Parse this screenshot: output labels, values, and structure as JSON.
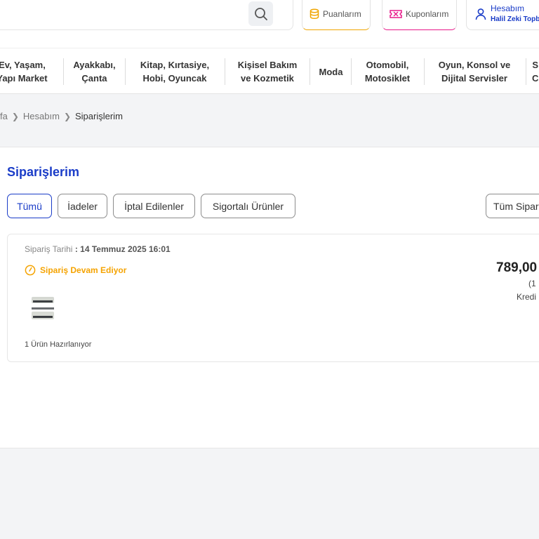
{
  "header": {
    "points_label": "Puanlarım",
    "coupons_label": "Kuponlarım",
    "account_title": "Hesabım",
    "account_name": "Halil Zeki Topb"
  },
  "categories": [
    {
      "line1": "Ev, Yaşam,",
      "line2": "Yapı Market"
    },
    {
      "line1": "Ayakkabı,",
      "line2": "Çanta"
    },
    {
      "line1": "Kitap, Kırtasiye,",
      "line2": "Hobi, Oyuncak"
    },
    {
      "line1": "Kişisel Bakım",
      "line2": "ve Kozmetik"
    },
    {
      "line1": "Moda",
      "line2": ""
    },
    {
      "line1": "Otomobil,",
      "line2": "Motosiklet"
    },
    {
      "line1": "Oyun, Konsol ve",
      "line2": "Dijital Servisler"
    },
    {
      "line1": "S",
      "line2": "C"
    }
  ],
  "breadcrumb": {
    "home": "fa",
    "account": "Hesabım",
    "current": "Siparişlerim"
  },
  "page": {
    "title": "Siparişlerim"
  },
  "filters": {
    "all": "Tümü",
    "returns": "İadeler",
    "cancelled": "İptal Edilenler",
    "insured": "Sigortalı Ürünler",
    "all_orders_select": "Tüm Sipar"
  },
  "order": {
    "date_label": "Sipariş Tarihi",
    "date_value": ": 14 Temmuz 2025 16:01",
    "status": "Sipariş Devam Ediyor",
    "items_note": "1 Ürün Hazırlanıyor",
    "price": "789,00",
    "item_count": "(1 ",
    "payment": "Kredi "
  },
  "colors": {
    "brand_blue": "#1a3cc8",
    "status_orange": "#f5a300",
    "coupon_pink": "#e8188a",
    "points_gold": "#f0a500"
  },
  "icons": {
    "search": "search-icon",
    "points": "coins-icon",
    "coupons": "ticket-icon",
    "account": "user-icon",
    "status": "clock-icon"
  }
}
